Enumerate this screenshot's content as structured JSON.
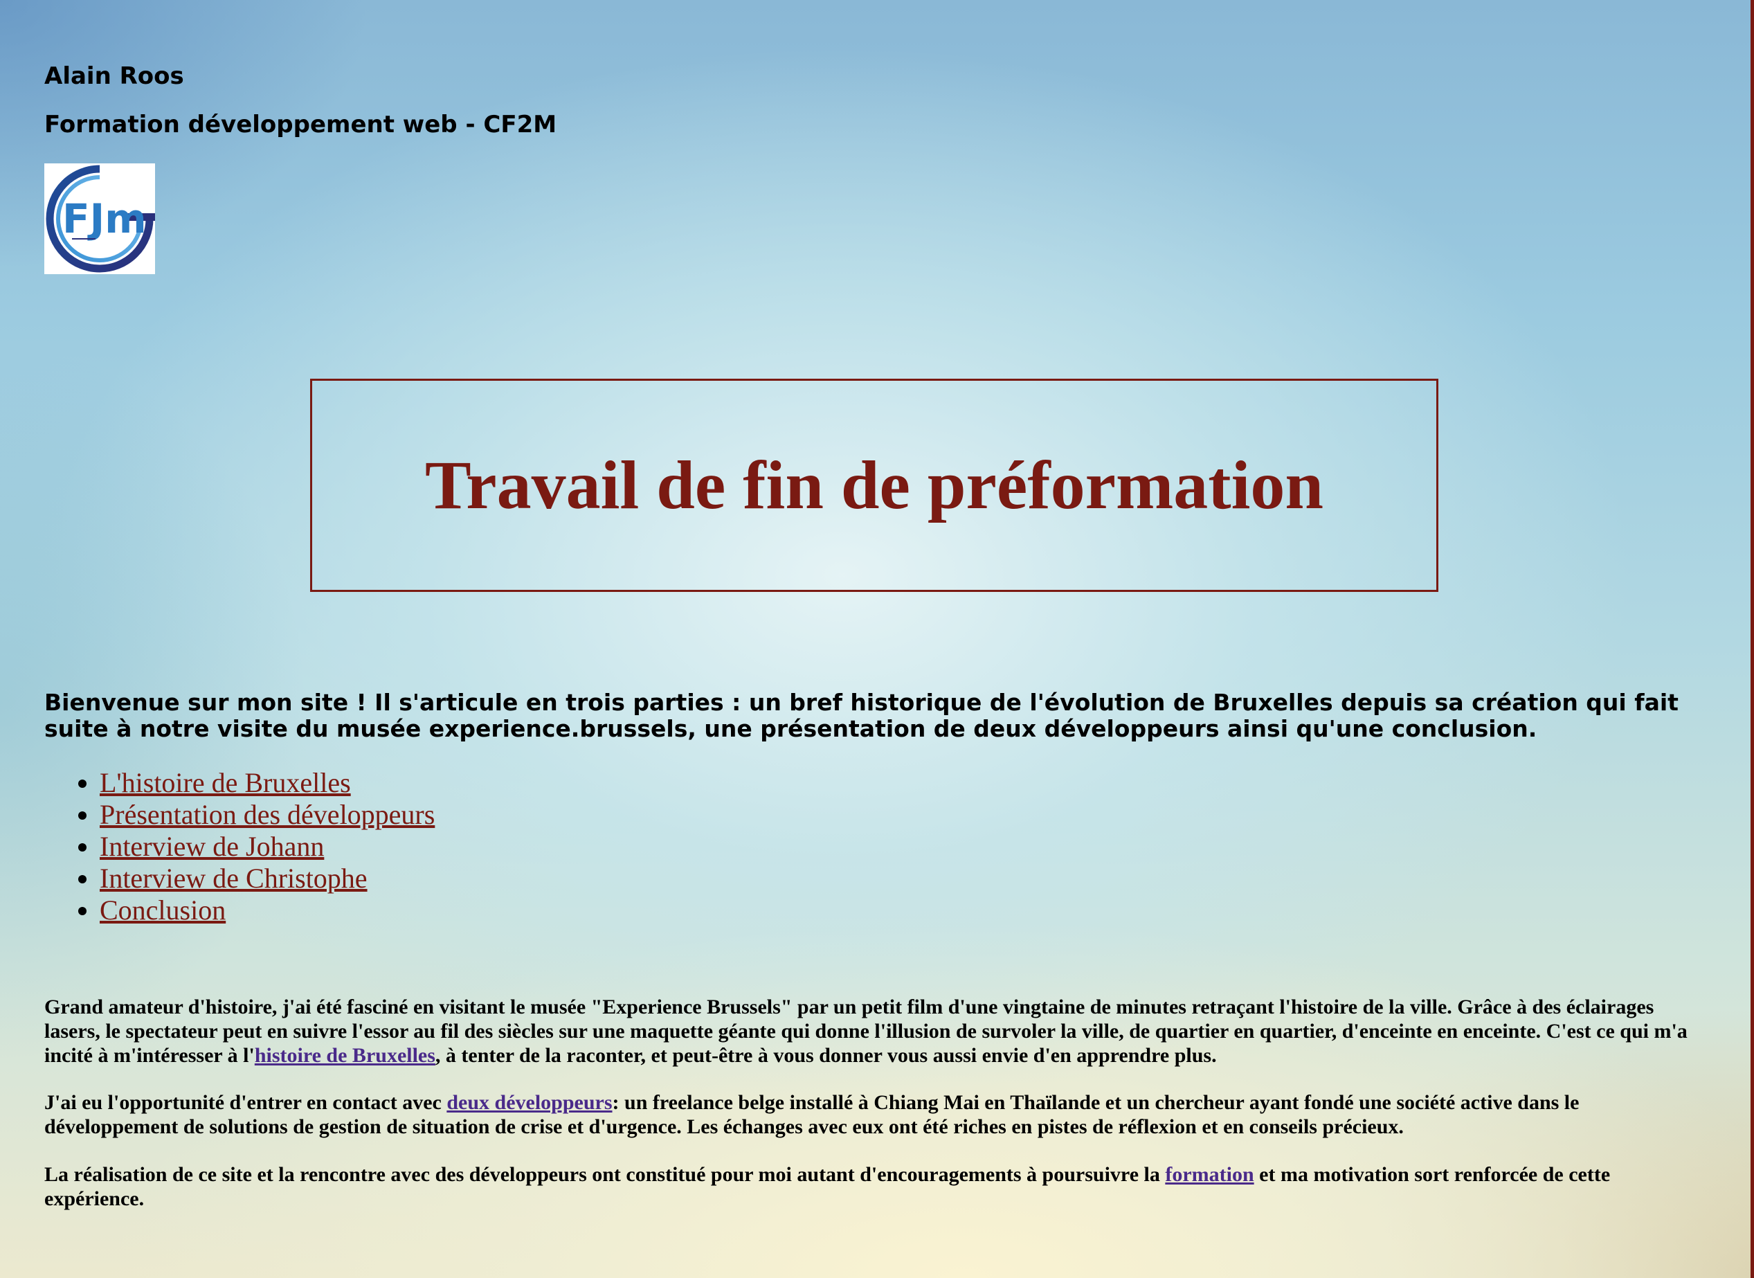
{
  "header": {
    "author": "Alain Roos",
    "formation": "Formation développement web - CF2M",
    "logo_text": "FJm"
  },
  "title": "Travail de fin de préformation",
  "welcome": "Bienvenue sur mon site ! Il s'articule en trois parties : un bref historique de l'évolution de Bruxelles depuis sa création qui fait suite à notre visite du musée experience.brussels, une présentation de deux développeurs ainsi qu'une conclusion.",
  "nav": {
    "items": [
      {
        "label": "L'histoire de Bruxelles"
      },
      {
        "label": "Présentation des développeurs"
      },
      {
        "label": "Interview de Johann"
      },
      {
        "label": "Interview de Christophe"
      },
      {
        "label": "Conclusion"
      }
    ]
  },
  "paragraphs": {
    "p1_before": "Grand amateur d'histoire, j'ai été fasciné en visitant le musée \"Experience Brussels\" par un petit film d'une vingtaine de minutes retraçant l'histoire de la ville. Grâce à des éclairages lasers, le spectateur peut en suivre l'essor au fil des siècles sur une maquette géante qui donne l'illusion de survoler la ville, de quartier en quartier, d'enceinte en enceinte. C'est ce qui m'a incité à m'intéresser à l'",
    "p1_link": "histoire de Bruxelles",
    "p1_after": ", à tenter de la raconter, et peut-être à vous donner vous aussi envie d'en apprendre plus.",
    "p2_before": "J'ai eu l'opportunité d'entrer en contact avec ",
    "p2_link": "deux développeurs",
    "p2_after": ": un freelance belge installé à Chiang Mai en Thaïlande et un chercheur ayant fondé une société active dans le développement de solutions de gestion de situation de crise et d'urgence. Les échanges avec eux ont été riches en pistes de réflexion et en conseils précieux.",
    "p3_before": "La réalisation de ce site et la rencontre avec des développeurs ont constitué pour moi autant d'encouragements à poursuivre la ",
    "p3_link": "formation",
    "p3_after": " et ma motivation sort renforcée de cette expérience."
  },
  "colors": {
    "accent": "#7a1a12",
    "visited_link": "#4a2a8a"
  }
}
